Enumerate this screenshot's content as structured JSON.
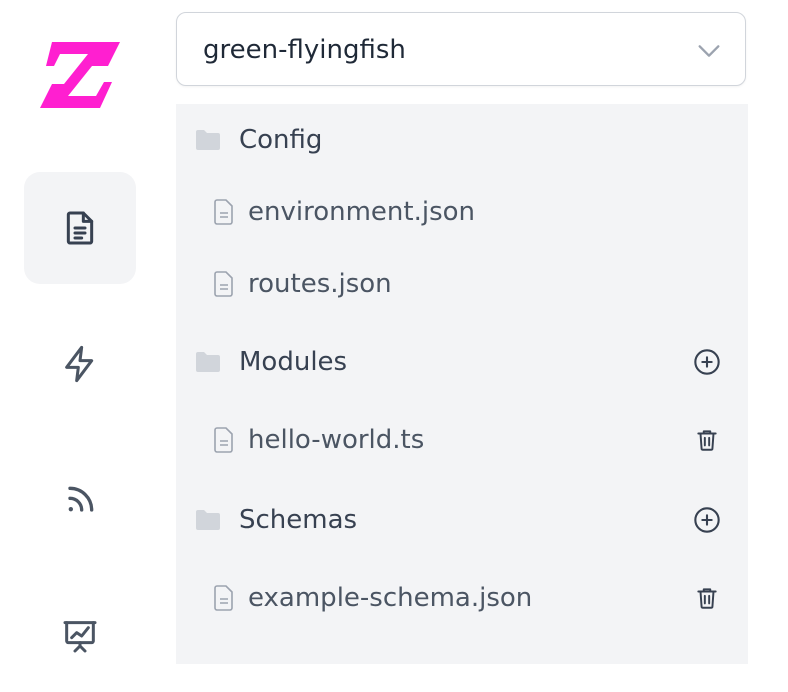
{
  "colors": {
    "brand": "#ff1fd0",
    "sidebar_active_bg": "#f3f4f6",
    "tree_bg": "#f3f4f6",
    "text": "#374151",
    "icon": "#4b5563"
  },
  "sidebar": {
    "logo": "logo-z",
    "items": [
      {
        "icon": "document-text-icon",
        "active": true
      },
      {
        "icon": "lightning-icon",
        "active": false
      },
      {
        "icon": "rss-icon",
        "active": false
      },
      {
        "icon": "presentation-chart-icon",
        "active": false
      }
    ]
  },
  "project_select": {
    "value": "green-flyingfish",
    "icon": "chevron-down-icon"
  },
  "tree": {
    "folders": [
      {
        "name": "Config",
        "can_add": false,
        "files": [
          {
            "name": "environment.json",
            "can_delete": false
          },
          {
            "name": "routes.json",
            "can_delete": false
          }
        ]
      },
      {
        "name": "Modules",
        "can_add": true,
        "files": [
          {
            "name": "hello-world.ts",
            "can_delete": true
          }
        ]
      },
      {
        "name": "Schemas",
        "can_add": true,
        "files": [
          {
            "name": "example-schema.json",
            "can_delete": true
          }
        ]
      }
    ]
  }
}
